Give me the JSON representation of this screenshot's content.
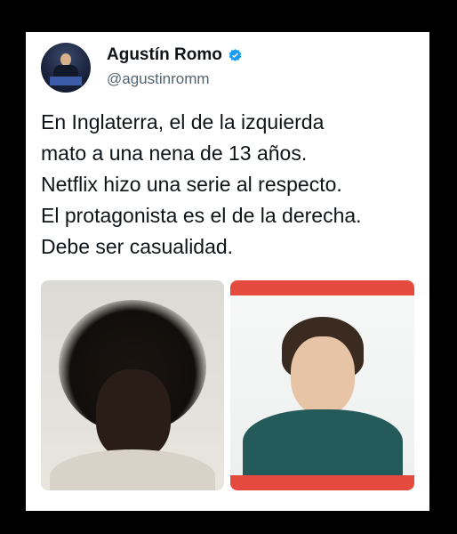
{
  "tweet": {
    "author": {
      "display_name": "Agustín Romo",
      "handle": "@agustinromm",
      "verified_icon": "verified-badge-icon",
      "verified_color": "#1d9bf0"
    },
    "text": "En Inglaterra, el de la izquierda\nmato a una nena de 13 años.\nNetflix hizo una serie al respecto.\nEl protagonista es el de la derecha.\nDebe ser casualidad.",
    "media": [
      {
        "icon": "photo-icon"
      },
      {
        "icon": "photo-icon",
        "accent": "#e54a3e"
      }
    ]
  }
}
